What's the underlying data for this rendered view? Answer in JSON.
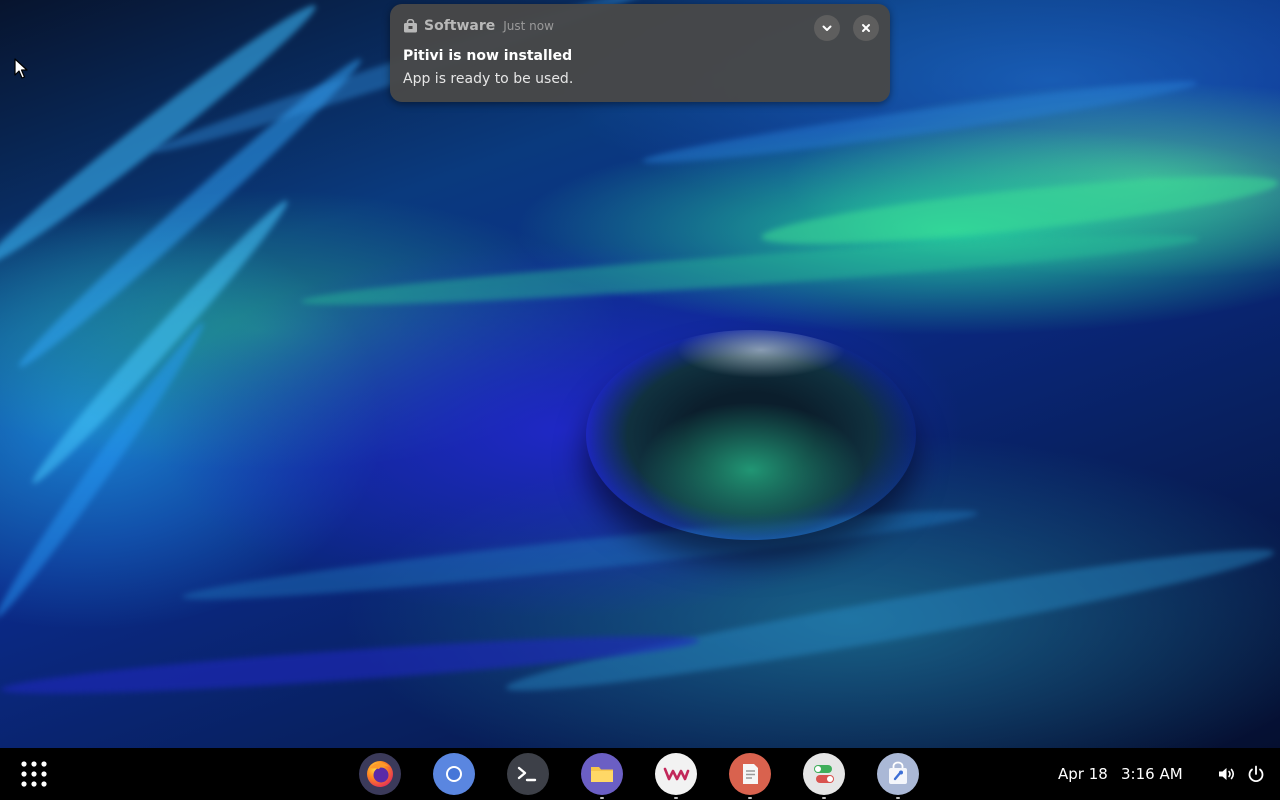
{
  "notification": {
    "app_icon": "software-bag-icon",
    "app_name": "Software",
    "time": "Just now",
    "title": "Pitivi is now installed",
    "body": "App is ready to be used."
  },
  "taskbar": {
    "apps_grid_icon": "apps-grid-icon",
    "dock": [
      {
        "name": "firefox",
        "icon": "firefox-icon",
        "running": false
      },
      {
        "name": "chromium",
        "icon": "chromium-icon",
        "running": false
      },
      {
        "name": "terminal",
        "icon": "terminal-icon",
        "running": false
      },
      {
        "name": "files",
        "icon": "files-icon",
        "running": true
      },
      {
        "name": "vm",
        "icon": "vm-icon",
        "running": true
      },
      {
        "name": "text-editor",
        "icon": "text-editor-icon",
        "running": true
      },
      {
        "name": "settings",
        "icon": "toggle-settings-icon",
        "running": true
      },
      {
        "name": "software",
        "icon": "software-store-icon",
        "running": true
      }
    ],
    "date": "Apr 18",
    "time": "3:16 AM",
    "tray": [
      "volume-icon",
      "power-icon"
    ]
  },
  "colors": {
    "taskbar_bg": "#000000",
    "notification_bg": "#484848"
  }
}
